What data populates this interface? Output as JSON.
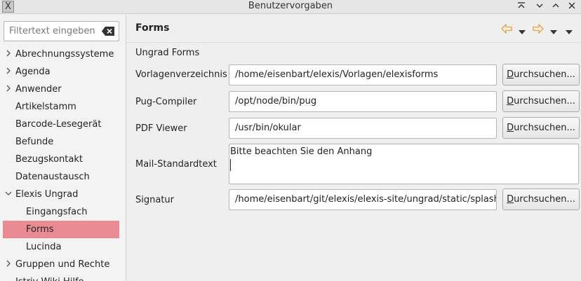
{
  "window": {
    "title": "Benutzervorgaben",
    "app_icon": "X",
    "controls": [
      "keep-above-icon",
      "minimize-icon",
      "maximize-icon",
      "close-icon"
    ]
  },
  "sidebar": {
    "filter_placeholder": "Filtertext eingeben",
    "items": [
      {
        "label": "Abrechnungssysteme",
        "expandable": true
      },
      {
        "label": "Agenda",
        "expandable": true
      },
      {
        "label": "Anwender",
        "expandable": true
      },
      {
        "label": "Artikelstamm"
      },
      {
        "label": "Barcode-Lesegerät"
      },
      {
        "label": "Befunde"
      },
      {
        "label": "Bezugskontakt"
      },
      {
        "label": "Datenaustausch"
      },
      {
        "label": "Elexis Ungrad",
        "expanded": true
      },
      {
        "label": "Eingangsfach",
        "child": true
      },
      {
        "label": "Forms",
        "child": true,
        "selected": true
      },
      {
        "label": "Lucinda",
        "child": true
      },
      {
        "label": "Gruppen und Rechte",
        "expandable": true
      },
      {
        "label": "Istriy Wiki Hilfe"
      }
    ]
  },
  "main": {
    "title": "Forms",
    "group_title": "Ungrad Forms",
    "fields": {
      "vorlagen": {
        "label": "Vorlagenverzeichnis",
        "value": "/home/eisenbart/elexis/Vorlagen/elexisforms"
      },
      "pug": {
        "label": "Pug-Compiler",
        "value": "/opt/node/bin/pug"
      },
      "pdf": {
        "label": "PDF Viewer",
        "value": "/usr/bin/okular"
      },
      "mail": {
        "label": "Mail-Standardtext",
        "value": "Bitte beachten Sie den Anhang"
      },
      "signatur": {
        "label": "Signatur",
        "value": "/home/eisenbart/git/elexis/elexis-site/ungrad/static/splash."
      }
    },
    "browse_mnemonic": "D",
    "browse_rest": "urchsuchen..."
  },
  "colors": {
    "selection": "#ea8a93",
    "nav_arrow": "#e8a33a"
  }
}
